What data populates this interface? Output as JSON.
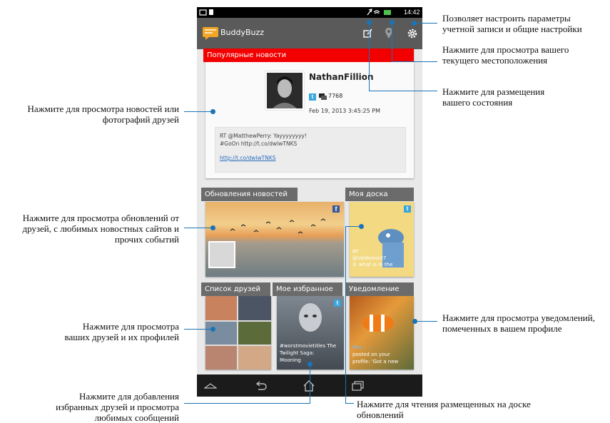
{
  "status_bar": {
    "time": "14:42"
  },
  "app_bar": {
    "title": "BuddyBuzz"
  },
  "popular": {
    "header": "Популярные новости",
    "user_name": "NathanFillion",
    "count": "7768",
    "date": "Feb 19, 2013 3:45:25 PM",
    "tweet_line1": "RT @MatthewPerry: Yayyyyyyyy!",
    "tweet_line2": "#GoOn http://t.co/dwlwTNKS",
    "tweet_link": "http://t.co/dwlwTNKS"
  },
  "tiles": {
    "news_updates": "Обновления новостей",
    "my_wall": "Моя доска",
    "my_wall_caption1": "RT",
    "my_wall_caption2": "@Voldemort7",
    "my_wall_caption3": "3: what is in the",
    "friends_list": "Список друзей",
    "favorites": "Мое избранное",
    "favorites_caption1": "#worstmovietitles The",
    "favorites_caption2": "Twilight Saga:",
    "favorites_caption3": "Mooning",
    "notifications": "Уведомление",
    "notif_caption1": "Mat... ...",
    "notif_caption2": "posted on your",
    "notif_caption3": "profile: 'Got a new"
  },
  "annotations": {
    "settings": [
      "Позволяет настроить параметры",
      "учетной записи и общие настройки"
    ],
    "location": [
      "Нажмите для просмотра вашего",
      "текущего местоположения"
    ],
    "status": [
      "Нажмите для размещения",
      "вашего состояния"
    ],
    "friends_news": [
      "Нажмите для просмотра новостей или",
      "фотографий друзей"
    ],
    "updates": [
      "Нажмите для просмотра обновлений от",
      "друзей, с любимых новостных сайтов и",
      "прочих событий"
    ],
    "friends_profiles": [
      "Нажмите для просмотра",
      "ваших друзей и их профилей"
    ],
    "notifications": [
      "Нажмите для просмотра уведомлений,",
      "помеченных в вашем профиле"
    ],
    "favorites": [
      "Нажмите для добавления",
      "избранных друзей и просмотра",
      "любимых сообщений"
    ],
    "wall": [
      "Нажмите для чтения размещенных на доске",
      "обновлений"
    ]
  },
  "colors": {
    "accent_red": "#f20000",
    "tile_header_gray": "#6b6b6b",
    "callout_blue": "#1a74b8"
  },
  "icons": [
    "compose-icon",
    "location-pin-icon",
    "settings-gear-icon",
    "back-icon",
    "home-icon",
    "recent-apps-icon",
    "facebook-icon",
    "twitter-icon"
  ]
}
